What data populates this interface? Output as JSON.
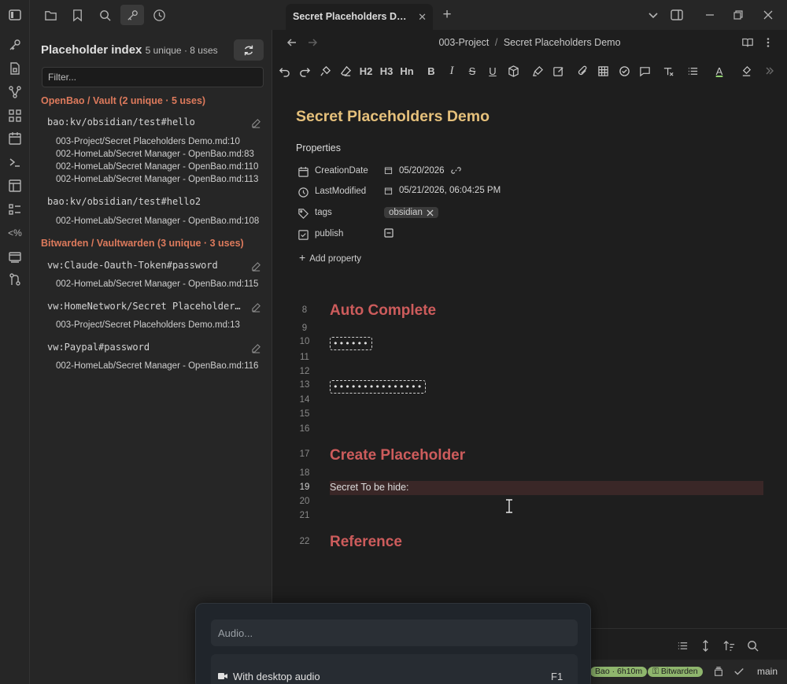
{
  "ribbon": {
    "icons": [
      "sidebar-toggle-icon",
      "key-icon",
      "file-lock-icon",
      "graph-icon",
      "grid-icon",
      "calendar-icon",
      "terminal-icon",
      "layout-icon",
      "list-icon",
      "code-percent-icon",
      "window-icon",
      "git-branch-icon"
    ],
    "code_label": "<%"
  },
  "left_toolbar": {
    "icons": [
      "folder-icon",
      "bookmark-icon",
      "search-icon",
      "key-icon",
      "clock-icon"
    ]
  },
  "sidebar": {
    "title": "Placeholder index",
    "subtitle": "5 unique · 8 uses",
    "filter_placeholder": "Filter...",
    "groups": [
      {
        "header": "OpenBao / Vault (2 unique · 5 uses)",
        "keys": [
          {
            "key": "bao:kv/obsidian/test#hello",
            "uses": [
              "003-Project/Secret Placeholders Demo.md:10",
              "002-HomeLab/Secret Manager - OpenBao.md:83",
              "002-HomeLab/Secret Manager - OpenBao.md:110",
              "002-HomeLab/Secret Manager - OpenBao.md:113"
            ]
          },
          {
            "key": "bao:kv/obsidian/test#hello2",
            "uses": [
              "002-HomeLab/Secret Manager - OpenBao.md:108"
            ]
          }
        ]
      },
      {
        "header": "Bitwarden / Vaultwarden (3 unique · 3 uses)",
        "keys": [
          {
            "key": "vw:Claude-Oauth-Token#password",
            "uses": [
              "002-HomeLab/Secret Manager - OpenBao.md:115"
            ]
          },
          {
            "key": "vw:HomeNetwork/Secret Placeholders Demo#password",
            "uses": [
              "003-Project/Secret Placeholders Demo.md:13"
            ]
          },
          {
            "key": "vw:Paypal#password",
            "uses": [
              "002-HomeLab/Secret Manager - OpenBao.md:116"
            ]
          }
        ]
      }
    ]
  },
  "tab": {
    "title": "Secret Placeholders Demo",
    "close": "✕",
    "new": "+"
  },
  "breadcrumb": {
    "folder": "003-Project",
    "sep": "/",
    "file": "Secret Placeholders Demo"
  },
  "toolbar": {
    "h2": "H2",
    "h3": "H3",
    "hn": "Hn",
    "bold": "B",
    "italic": "I",
    "strike": "S",
    "underline": "U",
    "text_color": "A"
  },
  "document": {
    "title": "Secret Placeholders Demo",
    "properties_label": "Properties",
    "properties": [
      {
        "key": "CreationDate",
        "value": "05/20/2026"
      },
      {
        "key": "LastModified",
        "value": "05/21/2026, 06:04:25 PM"
      },
      {
        "key": "tags",
        "value": "obsidian"
      },
      {
        "key": "publish",
        "value": ""
      }
    ],
    "add_property": "Add property",
    "lines": [
      {
        "n": "8"
      },
      {
        "n": "9"
      },
      {
        "n": "10"
      },
      {
        "n": "11"
      },
      {
        "n": "12"
      },
      {
        "n": "13"
      },
      {
        "n": "14"
      },
      {
        "n": "15"
      },
      {
        "n": "16"
      },
      {
        "n": "17"
      },
      {
        "n": "18"
      },
      {
        "n": "19"
      },
      {
        "n": "20"
      },
      {
        "n": "21"
      },
      {
        "n": "22"
      }
    ],
    "headings": {
      "auto_complete": "Auto Complete",
      "create_placeholder": "Create Placeholder",
      "reference": "Reference"
    },
    "masked_short": "••••••",
    "masked_long": "•••••••••••••••",
    "secret_line": "Secret To be hide:"
  },
  "status": {
    "bao_pill": "Bao · 6h10m",
    "bitwarden_pill": "Bitwarden",
    "branch": "main"
  },
  "overlay": {
    "audio_placeholder": "Audio...",
    "desktop_audio": "With desktop audio",
    "key": "F1"
  },
  "colors": {
    "accent_heading": "#cd5c5c",
    "title": "#e5c07b",
    "group_header": "#dd7a5c",
    "status_green": "#8fb66d"
  }
}
